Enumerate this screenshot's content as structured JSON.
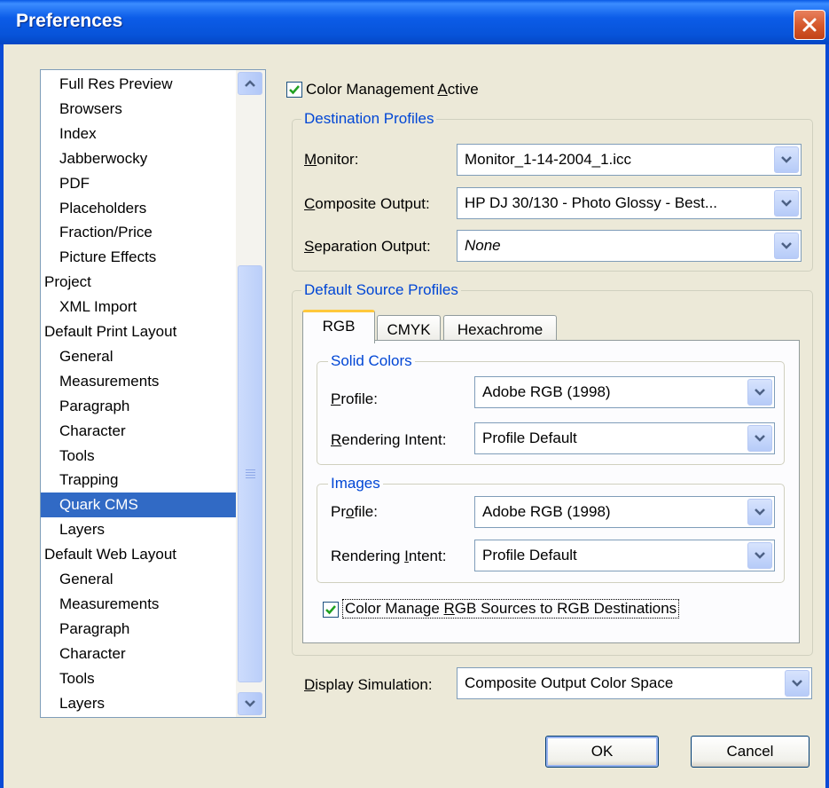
{
  "window": {
    "title": "Preferences"
  },
  "sidebar": {
    "items": [
      {
        "label": "Full Res Preview",
        "level": 1
      },
      {
        "label": "Browsers",
        "level": 1
      },
      {
        "label": "Index",
        "level": 1
      },
      {
        "label": "Jabberwocky",
        "level": 1
      },
      {
        "label": "PDF",
        "level": 1
      },
      {
        "label": "Placeholders",
        "level": 1
      },
      {
        "label": "Fraction/Price",
        "level": 1
      },
      {
        "label": "Picture Effects",
        "level": 1
      },
      {
        "label": "Project",
        "level": 0
      },
      {
        "label": "XML Import",
        "level": 1
      },
      {
        "label": "Default Print Layout",
        "level": 0
      },
      {
        "label": "General",
        "level": 1
      },
      {
        "label": "Measurements",
        "level": 1
      },
      {
        "label": "Paragraph",
        "level": 1
      },
      {
        "label": "Character",
        "level": 1
      },
      {
        "label": "Tools",
        "level": 1
      },
      {
        "label": "Trapping",
        "level": 1
      },
      {
        "label": "Quark CMS",
        "level": 1,
        "selected": true
      },
      {
        "label": "Layers",
        "level": 1
      },
      {
        "label": "Default Web Layout",
        "level": 0
      },
      {
        "label": "General",
        "level": 1
      },
      {
        "label": "Measurements",
        "level": 1
      },
      {
        "label": "Paragraph",
        "level": 1
      },
      {
        "label": "Character",
        "level": 1
      },
      {
        "label": "Tools",
        "level": 1
      },
      {
        "label": "Layers",
        "level": 1
      }
    ]
  },
  "cms": {
    "active_label_pre": "Color Management ",
    "active_label_u": "A",
    "active_label_post": "ctive",
    "active_checked": true
  },
  "destination": {
    "legend": "Destination Profiles",
    "monitor_u": "M",
    "monitor_rest": "onitor:",
    "monitor_value": "Monitor_1-14-2004_1.icc",
    "composite_u": "C",
    "composite_rest": "omposite Output:",
    "composite_value": "HP DJ 30/130 - Photo Glossy - Best...",
    "separation_u": "S",
    "separation_rest": "eparation Output:",
    "separation_value": "None"
  },
  "source": {
    "legend": "Default Source Profiles",
    "tabs": [
      "RGB",
      "CMYK",
      "Hexachrome"
    ],
    "active_tab": "RGB",
    "solid": {
      "legend": "Solid Colors",
      "profile_u": "P",
      "profile_rest": "rofile:",
      "profile_value": "Adobe RGB (1998)",
      "intent_u": "R",
      "intent_rest": "endering Intent:",
      "intent_value": "Profile Default"
    },
    "images": {
      "legend": "Images",
      "profile_pre": "Pr",
      "profile_u": "o",
      "profile_rest": "file:",
      "profile_value": "Adobe RGB (1998)",
      "intent_pre": "Rendering ",
      "intent_u": "I",
      "intent_rest": "ntent:",
      "intent_value": "Profile Default"
    },
    "manage_pre": "Color Manage ",
    "manage_u": "R",
    "manage_post": "GB Sources to RGB Destinations",
    "manage_checked": true
  },
  "display": {
    "label_u": "D",
    "label_rest": "isplay Simulation:",
    "value": "Composite Output Color Space"
  },
  "buttons": {
    "ok": "OK",
    "cancel": "Cancel"
  },
  "colors": {
    "titlebar": "#0753d8",
    "selection": "#316ac5",
    "legend_text": "#0046d5",
    "dialog_bg": "#ece9d8"
  }
}
